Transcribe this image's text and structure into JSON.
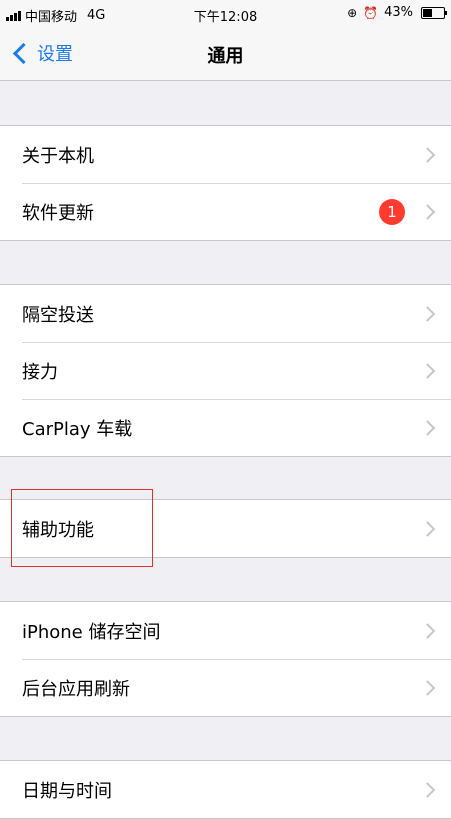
{
  "status_bar": {
    "carrier": "中国移动",
    "network": "4G",
    "time": "下午12:08",
    "battery_text": "43%",
    "battery_level": 0.43,
    "icons": [
      "signal-icon",
      "rotation-lock-icon",
      "alarm-icon",
      "battery-icon"
    ]
  },
  "nav": {
    "back_label": "设置",
    "title": "通用"
  },
  "groups": [
    {
      "items": [
        {
          "label": "关于本机"
        },
        {
          "label": "软件更新",
          "badge": "1"
        }
      ]
    },
    {
      "items": [
        {
          "label": "隔空投送"
        },
        {
          "label": "接力"
        },
        {
          "label": "CarPlay 车载"
        }
      ]
    },
    {
      "items": [
        {
          "label": "辅助功能",
          "highlighted": true
        }
      ]
    },
    {
      "items": [
        {
          "label": "iPhone 储存空间"
        },
        {
          "label": "后台应用刷新"
        }
      ]
    },
    {
      "items": [
        {
          "label": "日期与时间"
        }
      ]
    }
  ],
  "colors": {
    "accent": "#1b7bf0",
    "badge": "#ff3b30",
    "highlight": "#e0322a",
    "background": "#efeff4"
  }
}
